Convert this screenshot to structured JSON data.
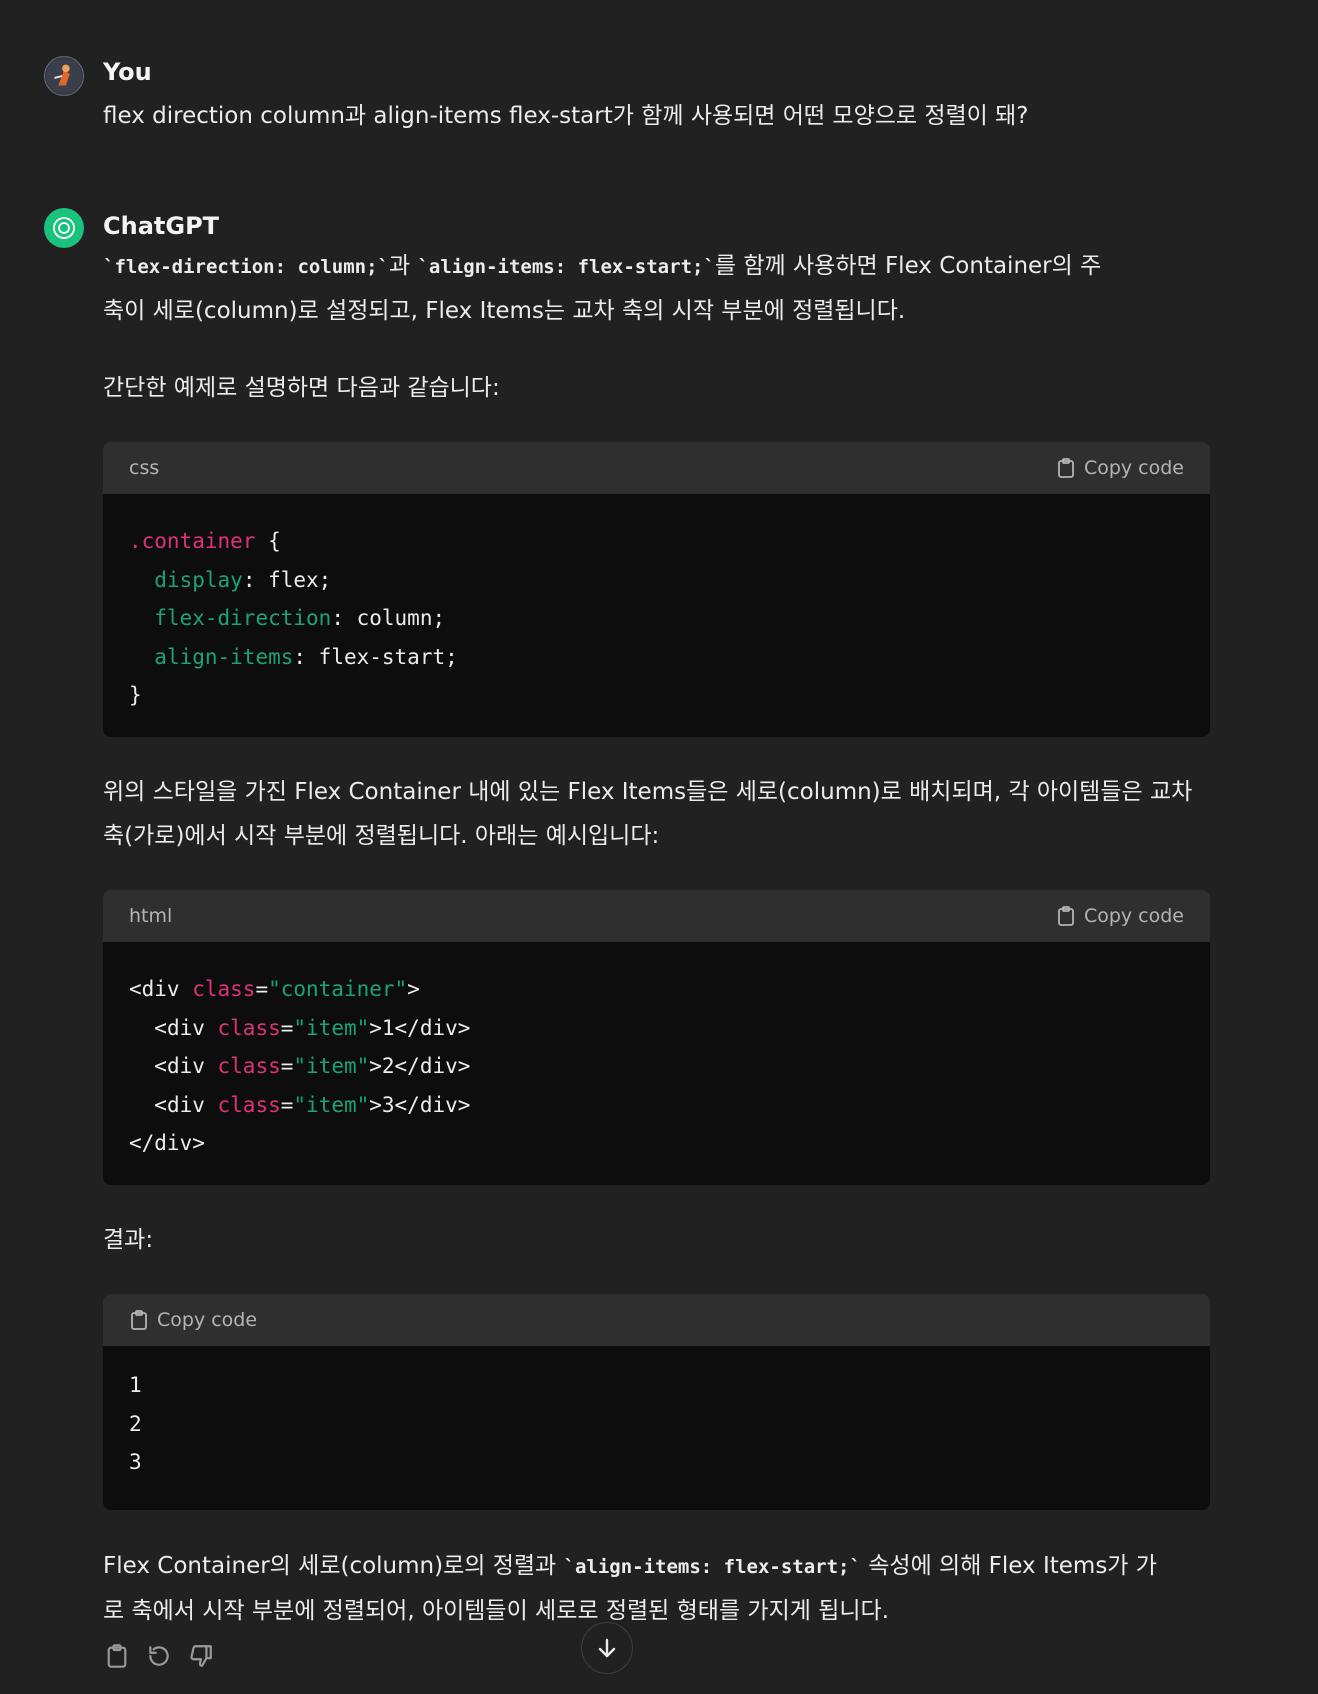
{
  "user_message": {
    "author": "You",
    "text": "flex direction column과 align-items flex-start가 함께 사용되면 어떤 모양으로 정렬이 돼?"
  },
  "assistant_message": {
    "author": "ChatGPT",
    "p1": {
      "code1": "`flex-direction: column;`",
      "mid1": "과 ",
      "code2": "`align-items: flex-start;`",
      "rest_line1": "를 함께 사용하면 Flex Container의 주",
      "line2": "축이 세로(column)로 설정되고, Flex Items는 교차 축의 시작 부분에 정렬됩니다."
    },
    "p2": "간단한 예제로 설명하면 다음과 같습니다:",
    "p3_line1": "위의 스타일을 가진 Flex Container 내에 있는 Flex Items들은 세로(column)로 배치되며, 각 아이템들은 교차",
    "p3_line2": "축(가로)에서 시작 부분에 정렬됩니다. 아래는 예시입니다:",
    "p4": "결과:",
    "p5": {
      "pre": "Flex Container의 세로(column)로의 정렬과 ",
      "code": "`align-items: flex-start;`",
      "rest_line1": " 속성에 의해 Flex Items가 가",
      "line2": "로 축에서 시작 부분에 정렬되어, 아이템들이 세로로 정렬된 형태를 가지게 됩니다."
    }
  },
  "code_blocks": {
    "css": {
      "lang": "css",
      "copy_label": "Copy code",
      "selector": ".container",
      "open": " {",
      "props": [
        {
          "name": "display",
          "value": "flex;"
        },
        {
          "name": "flex-direction",
          "value": "column;"
        },
        {
          "name": "align-items",
          "value": "flex-start;"
        }
      ],
      "close": "}"
    },
    "html": {
      "lang": "html",
      "copy_label": "Copy code",
      "outer_open": {
        "tag": "<div ",
        "attr": "class",
        "eq": "=",
        "str": "\"container\"",
        "end": ">"
      },
      "items": [
        {
          "tag": "<div ",
          "attr": "class",
          "eq": "=",
          "str": "\"item\"",
          "end": ">1</div>"
        },
        {
          "tag": "<div ",
          "attr": "class",
          "eq": "=",
          "str": "\"item\"",
          "end": ">2</div>"
        },
        {
          "tag": "<div ",
          "attr": "class",
          "eq": "=",
          "str": "\"item\"",
          "end": ">3</div>"
        }
      ],
      "outer_close": "</div>"
    },
    "result": {
      "copy_label": "Copy code",
      "lines": [
        "1",
        "2",
        "3"
      ]
    }
  },
  "icons": [
    "user-avatar-icon",
    "chatgpt-logo-icon",
    "clipboard-icon",
    "regenerate-icon",
    "thumbs-down-icon",
    "arrow-down-icon"
  ],
  "colors": {
    "background": "#212121",
    "code_bg": "#0d0d0d",
    "code_header": "#2f2f2f",
    "selector": "#df3079",
    "property": "#1aa37a"
  }
}
